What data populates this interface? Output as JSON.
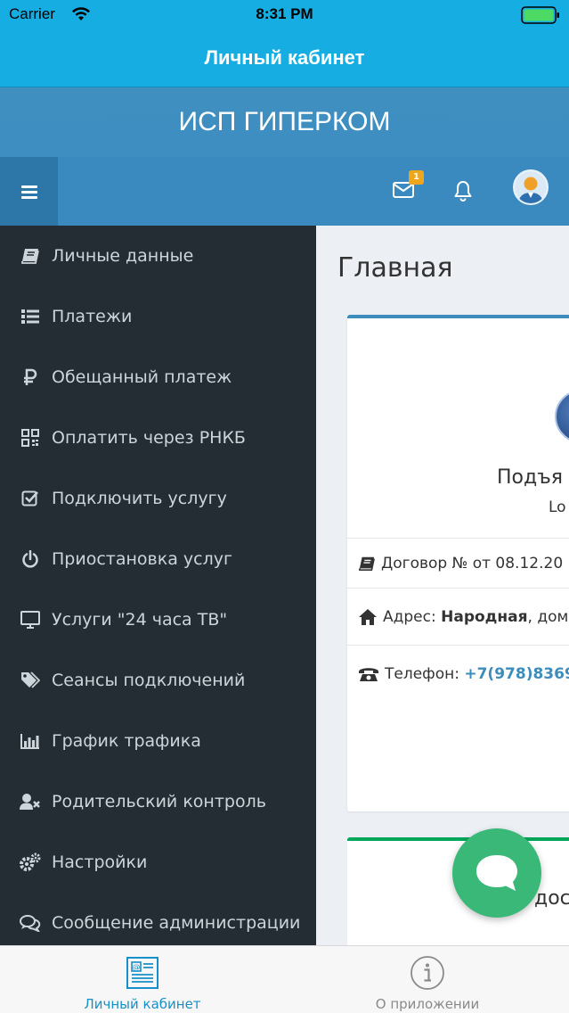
{
  "status_bar": {
    "carrier": "Carrier",
    "time": "8:31 PM",
    "battery_color": "#4cd964"
  },
  "app_bar": {
    "title": "Личный кабинет"
  },
  "brand": {
    "title": "ИСП ГИПЕРКОМ"
  },
  "toolbar": {
    "menu_icon": "hamburger-icon",
    "mail_icon": "envelope-icon",
    "mail_badge": "1",
    "bell_icon": "bell-icon",
    "avatar_icon": "user-avatar-icon"
  },
  "sidebar": {
    "items": [
      {
        "label": "Личные данные",
        "icon": "book-icon"
      },
      {
        "label": "Платежи",
        "icon": "list-icon"
      },
      {
        "label": "Обещанный платеж",
        "icon": "ruble-icon"
      },
      {
        "label": "Оплатить через РНКБ",
        "icon": "qrcode-icon"
      },
      {
        "label": "Подключить услугу",
        "icon": "checkbox-icon"
      },
      {
        "label": "Приостановка услуг",
        "icon": "power-icon"
      },
      {
        "label": "Услуги \"24 часа ТВ\"",
        "icon": "monitor-icon"
      },
      {
        "label": "Сеансы подключений",
        "icon": "tags-icon"
      },
      {
        "label": "График трафика",
        "icon": "bar-chart-icon"
      },
      {
        "label": "Родительский контроль",
        "icon": "user-times-icon"
      },
      {
        "label": "Настройки",
        "icon": "cogs-icon"
      },
      {
        "label": "Сообщение администрации",
        "icon": "comments-icon"
      }
    ]
  },
  "main": {
    "title": "Главная",
    "profile_card": {
      "name": "Подъя",
      "subtitle": "Lo",
      "contract_label": "Договор №",
      "contract_date": "от 08.12.20",
      "address_label": "Адрес:",
      "address_street": "Народная",
      "address_rest": ", дом",
      "phone_label": "Телефон:",
      "phone_value": "+7(978)8369"
    },
    "second_card": {
      "text": "дост"
    }
  },
  "chat_fab": {
    "icon": "chat-bubble-icon",
    "color": "#3ab877"
  },
  "tab_bar": {
    "tabs": [
      {
        "label": "Личный кабинет",
        "icon": "newspaper-icon",
        "active": true
      },
      {
        "label": "О приложении",
        "icon": "info-icon",
        "active": false
      }
    ],
    "active_color": "#1690c8"
  }
}
